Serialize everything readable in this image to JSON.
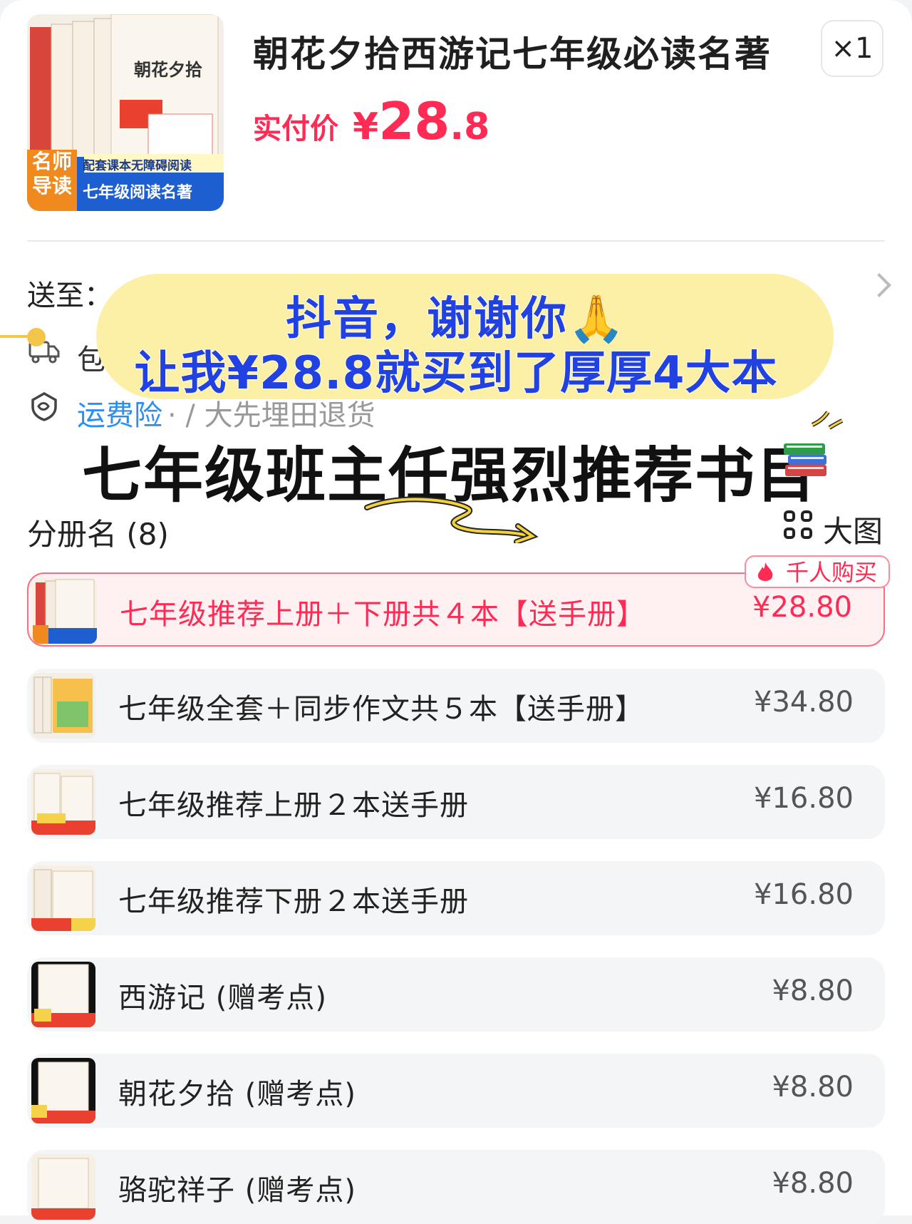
{
  "product": {
    "title": "朝花夕拾西游记七年级必读名著",
    "pay_label": "实付价",
    "currency": "¥",
    "price_int": "28",
    "price_dec": ".8",
    "quantity": "×1",
    "thumb_texts": [
      "名师导读",
      "配套课本无障碍阅读",
      "七年级阅读名著",
      "朝花夕拾"
    ]
  },
  "shipping": {
    "to_label": "送至：",
    "pack_text": "包",
    "insurance": "运费险",
    "insurance_tail": "· / 大先埋田退货"
  },
  "overlay": {
    "line1": "抖音，谢谢你🙏",
    "line2": "让我¥28.8就买到了厚厚4大本",
    "line3": "七年级班主任强烈推荐书目"
  },
  "variants": {
    "title": "分册名 (8)",
    "view_label": "大图",
    "hot_badge": "千人购买",
    "items": [
      {
        "name": "七年级推荐上册＋下册共４本【送手册】",
        "price": "¥28.80",
        "selected": true
      },
      {
        "name": "七年级全套＋同步作文共５本【送手册】",
        "price": "¥34.80",
        "selected": false
      },
      {
        "name": "七年级推荐上册２本送手册",
        "price": "¥16.80",
        "selected": false
      },
      {
        "name": "七年级推荐下册２本送手册",
        "price": "¥16.80",
        "selected": false
      },
      {
        "name": "西游记 (赠考点)",
        "price": "¥8.80",
        "selected": false
      },
      {
        "name": "朝花夕拾 (赠考点)",
        "price": "¥8.80",
        "selected": false
      },
      {
        "name": "骆驼祥子 (赠考点)",
        "price": "¥8.80",
        "selected": false
      }
    ]
  },
  "colors": {
    "accent": "#ff2b55",
    "overlay_text": "#2142e0",
    "overlay_bg": "#fcf0a6",
    "link": "#2b8ef7"
  },
  "icons": [
    "book-cover-image",
    "truck-icon",
    "shield-icon",
    "chevron-right-icon",
    "grid-icon",
    "flame-icon",
    "books-emoji-icon"
  ]
}
